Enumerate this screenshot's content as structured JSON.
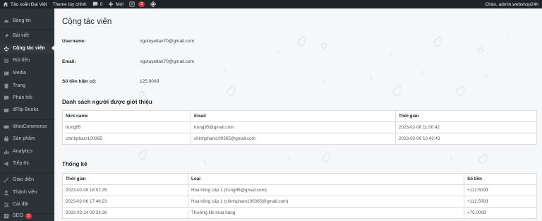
{
  "adminbar": {
    "site_name": "Tảo xoắn Đại Việt",
    "theme_custom": "Theme tùy chỉnh",
    "comments_count": "0",
    "new_label": "Mới",
    "yoast_badge": "2",
    "greeting": "Chào, admin.webshop24h"
  },
  "sidebar": {
    "items": [
      {
        "label": "Bảng tin",
        "icon": "dashboard-icon"
      },
      {
        "label": "Bài viết",
        "icon": "pin-icon"
      },
      {
        "label": "Cộng tác viên",
        "icon": "users-group-icon",
        "active": true
      },
      {
        "label": "Rút tiền",
        "icon": "list-icon"
      },
      {
        "label": "Media",
        "icon": "media-icon"
      },
      {
        "label": "Trang",
        "icon": "page-icon"
      },
      {
        "label": "Phản hồi",
        "icon": "comment-icon"
      },
      {
        "label": "dFlip Books",
        "icon": "book-icon"
      },
      {
        "label": "WooCommerce",
        "icon": "woo-icon"
      },
      {
        "label": "Sản phẩm",
        "icon": "product-icon"
      },
      {
        "label": "Analytics",
        "icon": "chart-icon"
      },
      {
        "label": "Tiếp thị",
        "icon": "megaphone-icon"
      },
      {
        "label": "Giao diện",
        "icon": "brush-icon"
      },
      {
        "label": "Thành viên",
        "icon": "user-icon"
      },
      {
        "label": "Cài đặt",
        "icon": "settings-icon"
      },
      {
        "label": "SEO",
        "icon": "yoast-icon",
        "badge": "2"
      }
    ]
  },
  "page": {
    "title": "Cộng tác viên",
    "username_label": "Username:",
    "username_value": "ngotuyetlan70@gmail.com",
    "email_label": "Email:",
    "email_value": "ngotuyetlan70@gmail.com",
    "balance_label": "Số tiền hiện có:",
    "balance_value": "125.000đ"
  },
  "referrals": {
    "title": "Danh sách người được giới thiệu",
    "columns": [
      "Nick name",
      "Email",
      "Thời gian"
    ],
    "rows": [
      [
        "trung95",
        "trung95@gmail.com",
        "2023-02-06 11:00:42"
      ],
      [
        "chinhpham100365",
        "chinhpham100365@gmail.com",
        "2023-02-06 10:43:43"
      ]
    ]
  },
  "stats": {
    "title": "Thống kê",
    "columns": [
      "Thời gian",
      "Loại",
      "Số tiền"
    ],
    "rows": [
      [
        "2023-02-06 18:02:25",
        "Hoa hồng cấp 1 (trung95@gmail.com)",
        "+112.500đ"
      ],
      [
        "2023-02-06 17:46:23",
        "Hoa hồng cấp 1 (chinhpham100365@gmail.com)",
        "+112.500đ"
      ],
      [
        "2022-02-24 09:33:36",
        "Thưởng khi mua hàng",
        "+75.000đ"
      ]
    ]
  }
}
